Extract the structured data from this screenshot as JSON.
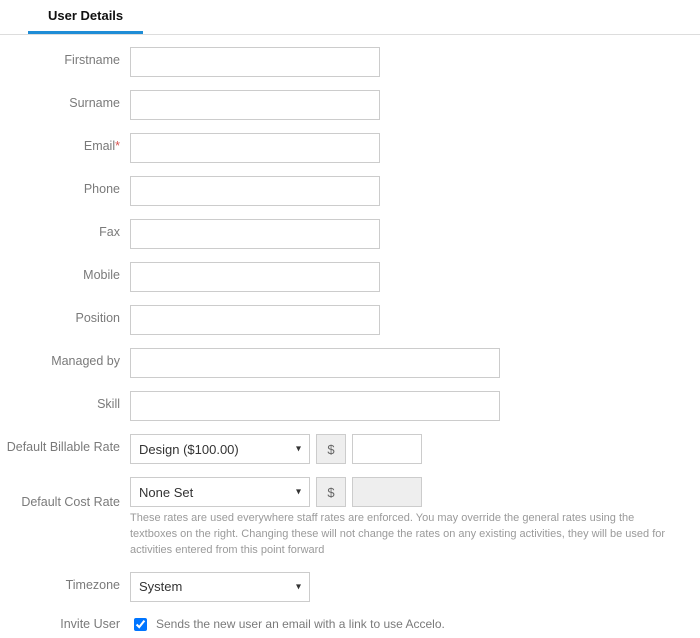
{
  "tabs": {
    "active": "User Details"
  },
  "labels": {
    "firstname": "Firstname",
    "surname": "Surname",
    "email": "Email",
    "phone": "Phone",
    "fax": "Fax",
    "mobile": "Mobile",
    "position": "Position",
    "managed_by": "Managed by",
    "skill": "Skill",
    "billable_rate": "Default Billable Rate",
    "cost_rate": "Default Cost Rate",
    "timezone": "Timezone",
    "invite_user": "Invite User"
  },
  "values": {
    "firstname": "",
    "surname": "",
    "email": "",
    "phone": "",
    "fax": "",
    "mobile": "",
    "position": "",
    "managed_by": "",
    "skill": "",
    "billable_rate_select": "Design ($100.00)",
    "billable_rate_amount": "",
    "cost_rate_select": "None Set",
    "cost_rate_amount": "",
    "timezone_select": "System",
    "invite_checked": true
  },
  "symbols": {
    "required": "*",
    "currency": "$",
    "caret": "▾"
  },
  "hints": {
    "rates": "These rates are used everywhere staff rates are enforced. You may override the general rates using the textboxes on the right. Changing these will not change the rates on any existing activities, they will be used for activities entered from this point forward",
    "invite": "Sends the new user an email with a link to use Accelo."
  }
}
